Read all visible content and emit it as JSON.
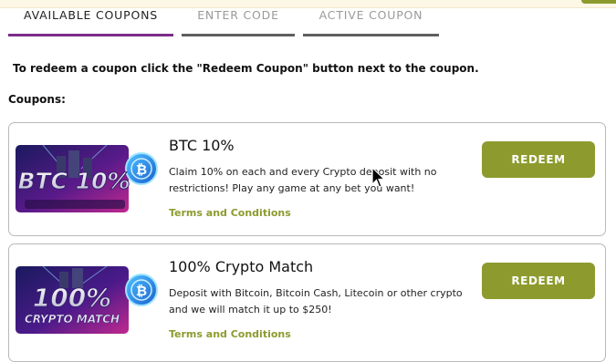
{
  "tabs": [
    {
      "label": "AVAILABLE COUPONS",
      "active": true
    },
    {
      "label": "ENTER CODE",
      "active": false
    },
    {
      "label": "ACTIVE COUPON",
      "active": false
    }
  ],
  "instructions": "To redeem a coupon click the \"Redeem Coupon\" button next to the coupon.",
  "section_title": "Coupons:",
  "coupons": [
    {
      "title": "BTC 10%",
      "description": "Claim 10% on each and every Crypto deposit with no restrictions! Play any game at any bet you want!",
      "terms_label": "Terms and Conditions",
      "redeem_label": "REDEEM",
      "image_text": "BTC 10%",
      "coin_symbol": "₿"
    },
    {
      "title": "100% Crypto Match",
      "description": "Deposit with Bitcoin, Bitcoin Cash, Litecoin or other crypto and we will match it up to $250!",
      "terms_label": "Terms and Conditions",
      "redeem_label": "REDEEM",
      "image_text_line1": "100%",
      "image_text_line2": "CRYPTO MATCH",
      "coin_symbol": "₿"
    }
  ],
  "colors": {
    "accent": "#8d9b2e",
    "active_tab_underline": "#7b2b8a",
    "inactive_tab_underline": "#5f5f5f"
  }
}
